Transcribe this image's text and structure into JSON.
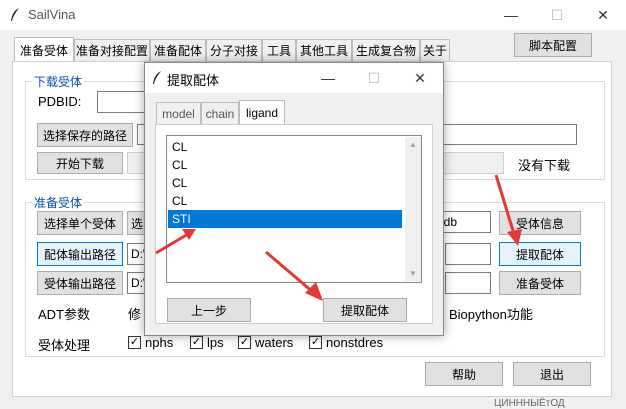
{
  "window": {
    "title": "SailVina",
    "minimize": "—",
    "maximize": "☐",
    "close": "✕"
  },
  "tabs": [
    "准备受体",
    "准备对接配置",
    "准备配体",
    "分子对接",
    "工具",
    "其他工具",
    "生成复合物",
    "关于"
  ],
  "script_config_button": "脚本配置",
  "download_group": {
    "title": "下载受体",
    "pdbid_label": "PDBID:",
    "pdbid_value": "",
    "choose_save_path": "选择保存的路径",
    "save_path_value": "",
    "start_download": "开始下载",
    "status": "没有下载"
  },
  "prepare_group": {
    "title": "准备受体",
    "select_single_receptor": "选择单个受体",
    "select_prefix": "选",
    "pdb_suffix": "pdb",
    "receptor_info": "受体信息",
    "ligand_output_path": "配体输出路径",
    "ligand_output_value": "D:\\",
    "extract_ligand": "提取配体",
    "receptor_output_path": "受体输出路径",
    "receptor_output_value": "D:\\",
    "prepare_receptor": "准备受体",
    "adt_params_label": "ADT参数",
    "repair_prefix": "修",
    "biopython_label": "Biopython功能",
    "receptor_processing_label": "受体处理",
    "checks": [
      "nphs",
      "lps",
      "waters",
      "nonstdres"
    ]
  },
  "bottom": {
    "help": "帮助",
    "exit": "退出"
  },
  "background_text": "ЦИНННЫЁтОД",
  "dialog": {
    "title": "提取配体",
    "minimize": "—",
    "maximize": "☐",
    "close": "✕",
    "tabs": [
      "model",
      "chain",
      "ligand"
    ],
    "active_tab": "ligand",
    "list_items": [
      "CL",
      "CL",
      "CL",
      "CL",
      "STI"
    ],
    "selected_item": "STI",
    "prev_step": "上一步",
    "extract_ligand": "提取配体"
  },
  "colors": {
    "accent": "#0078d7",
    "group_title": "#0a4fa8",
    "annotation_arrow": "#e53935"
  }
}
